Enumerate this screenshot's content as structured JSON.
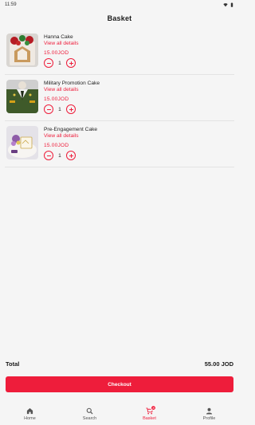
{
  "status_bar": {
    "time": "11:59"
  },
  "header": {
    "title": "Basket"
  },
  "items": [
    {
      "name": "Hanna Cake",
      "details_label": "View all details",
      "price": "15.00JOD",
      "quantity": "1"
    },
    {
      "name": "Military Promotion Cake",
      "details_label": "View all details",
      "price": "15.00JOD",
      "quantity": "1"
    },
    {
      "name": "Pre-Engagement Cake",
      "details_label": "View all details",
      "price": "15.00JOD",
      "quantity": "1"
    }
  ],
  "summary": {
    "total_label": "Total",
    "total_value": "55.00 JOD"
  },
  "checkout_label": "Checkout",
  "nav": {
    "home": "Home",
    "search": "Search",
    "basket": "Basket",
    "basket_badge": "3",
    "profile": "Profile"
  },
  "colors": {
    "accent": "#ee1d3b",
    "background": "#f5f5f5"
  },
  "icons": [
    "wifi-icon",
    "battery-icon",
    "minus-icon",
    "plus-icon",
    "home-icon",
    "search-icon",
    "cart-icon",
    "person-icon"
  ]
}
